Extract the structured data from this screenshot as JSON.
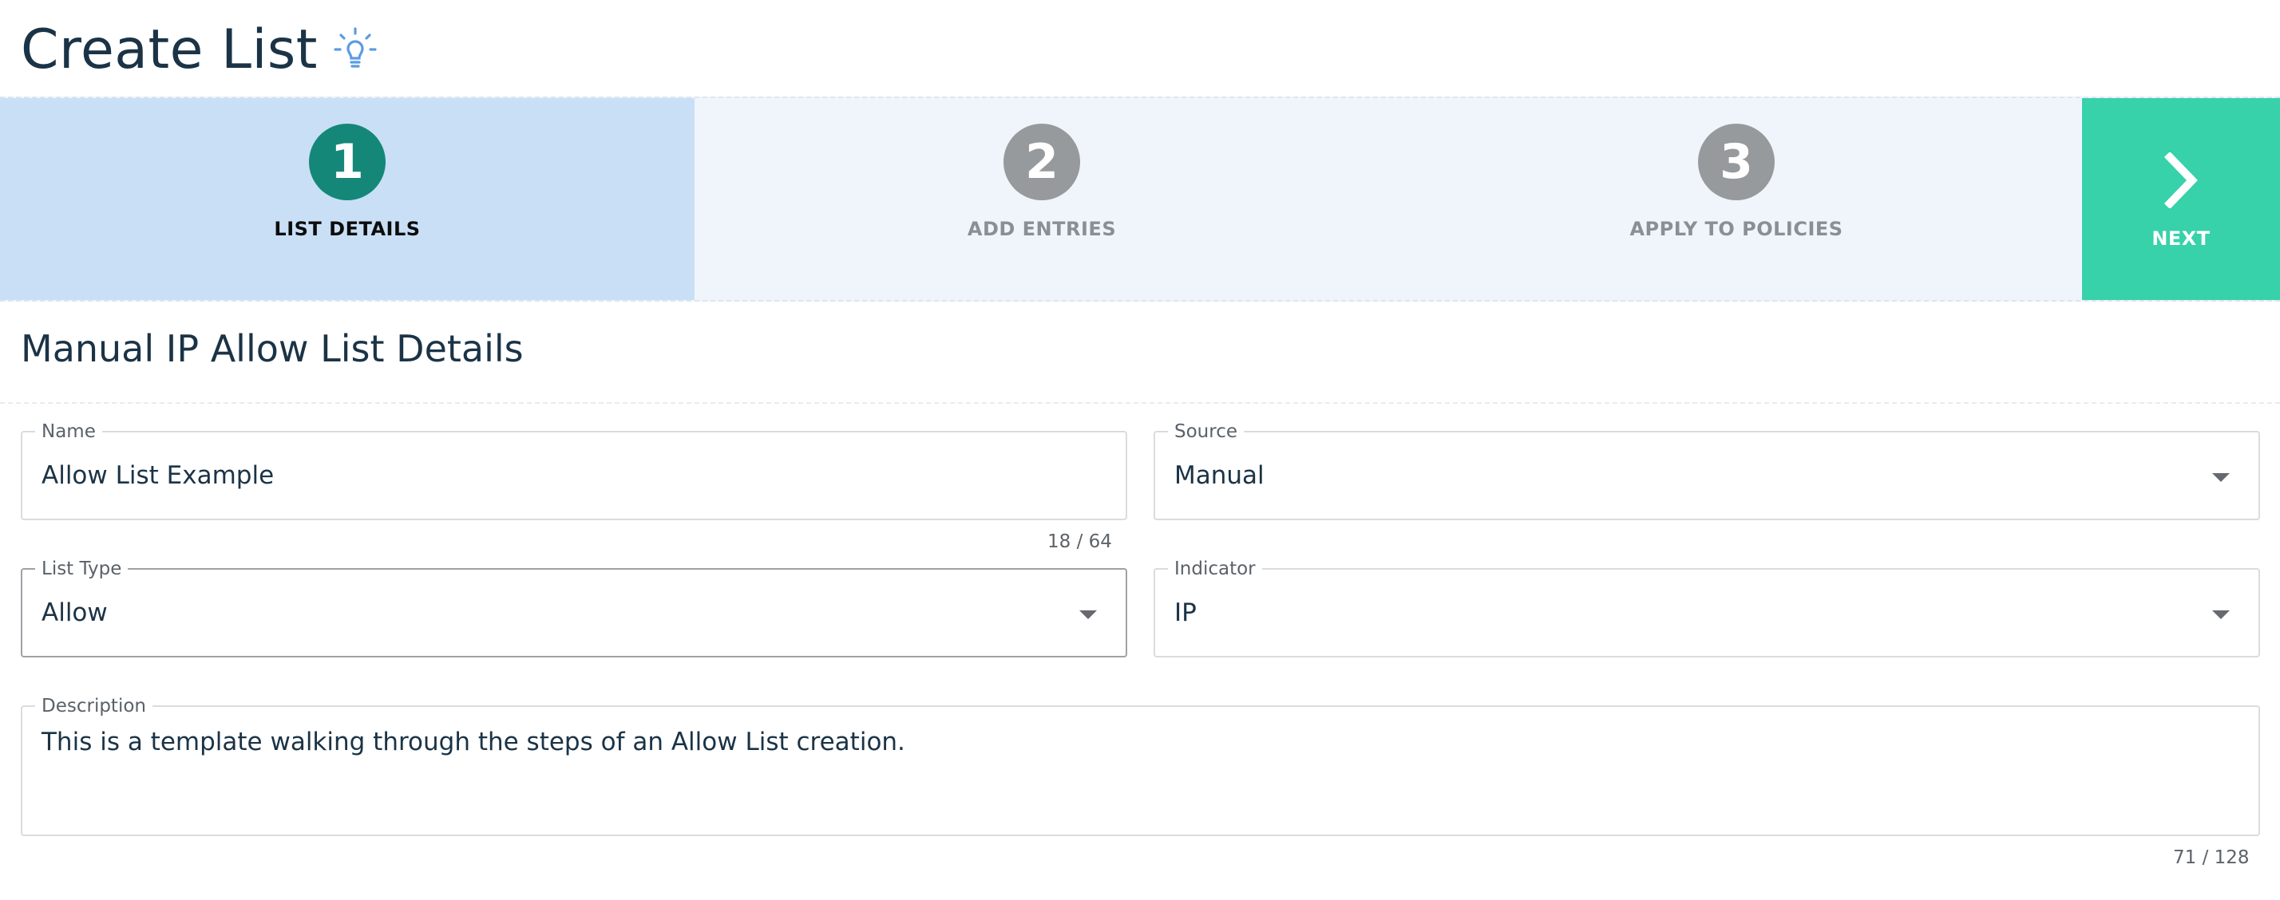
{
  "header": {
    "title": "Create List",
    "icon": "lightbulb-icon"
  },
  "stepper": {
    "steps": [
      {
        "number": "1",
        "label": "LIST DETAILS",
        "active": true
      },
      {
        "number": "2",
        "label": "ADD ENTRIES",
        "active": false
      },
      {
        "number": "3",
        "label": "APPLY TO POLICIES",
        "active": false
      }
    ],
    "next_label": "NEXT"
  },
  "section": {
    "title": "Manual IP Allow List Details"
  },
  "form": {
    "name": {
      "label": "Name",
      "value": "Allow List Example",
      "counter": "18 / 64"
    },
    "source": {
      "label": "Source",
      "value": "Manual"
    },
    "list_type": {
      "label": "List Type",
      "value": "Allow"
    },
    "indicator": {
      "label": "Indicator",
      "value": "IP"
    },
    "description": {
      "label": "Description",
      "value": "This is a template walking through the steps of an Allow List creation.",
      "counter": "71 / 128"
    }
  },
  "colors": {
    "active_step_bg": "#c9dff6",
    "inactive_step_bg": "#f0f5fb",
    "active_circle": "#148778",
    "inactive_circle": "#979a9c",
    "next_bg": "#37d1aa",
    "text_primary": "#1b3346"
  }
}
